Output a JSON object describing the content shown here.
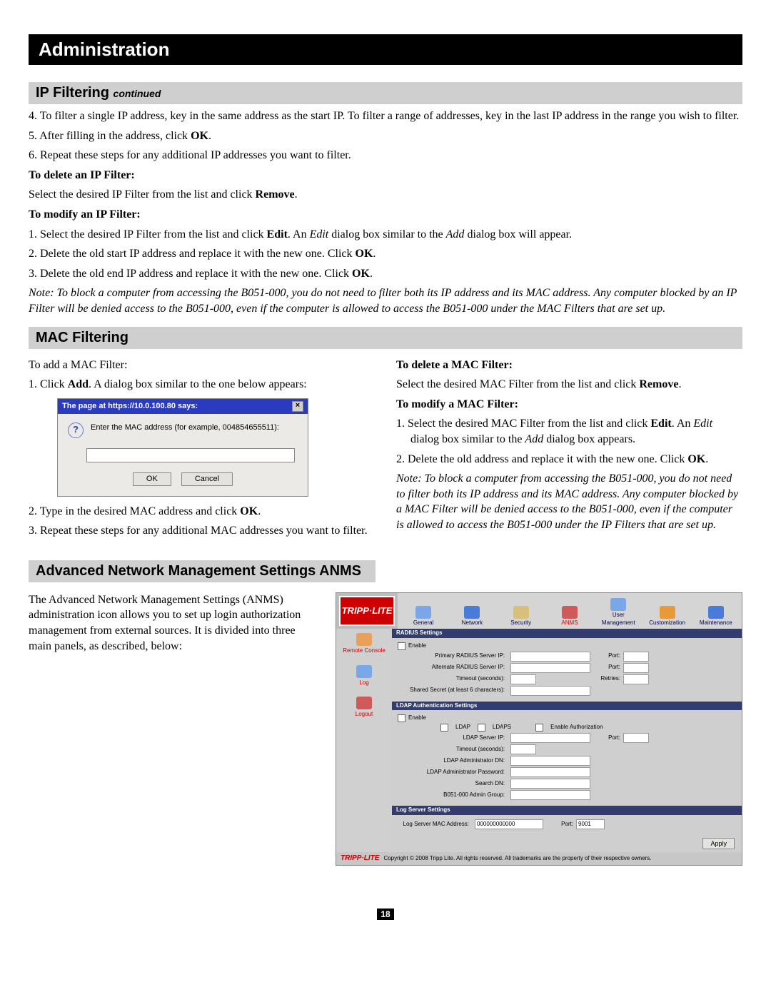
{
  "title": "Administration",
  "ip_filter": {
    "heading": "IP Filtering",
    "heading_sub": "continued",
    "step4": "4. To filter a single IP address, key in the same address as the start IP. To filter a range of addresses, key in the last IP address in the range you wish to filter.",
    "step5_pre": "5. After filling in the address, click ",
    "step5_b": "OK",
    "step5_post": ".",
    "step6": "6. Repeat these steps for any additional IP addresses you want to filter.",
    "delete_h": "To delete an IP Filter:",
    "delete_pre": "Select the desired IP Filter from the list and click ",
    "delete_b": "Remove",
    "delete_post": ".",
    "modify_h": "To modify an IP Filter:",
    "m1_pre": "1. Select the desired IP Filter from the list and click ",
    "m1_b": "Edit",
    "m1_mid": ". An ",
    "m1_i1": "Edit",
    "m1_mid2": " dialog box similar to the ",
    "m1_i2": "Add",
    "m1_post": " dialog box will appear.",
    "m2_pre": "2. Delete the old start IP address and replace it with the new one. Click ",
    "m2_b": "OK",
    "m2_post": ".",
    "m3_pre": "3. Delete the old end IP address and replace it with the new one. Click ",
    "m3_b": "OK",
    "m3_post": ".",
    "note": "Note: To block a computer from accessing the B051-000, you do not need to filter both its IP address and its MAC address. Any computer blocked by an IP Filter will be denied access to the B051-000, even if the computer is allowed to access the B051-000 under the MAC Filters that are set up."
  },
  "mac": {
    "heading": "MAC Filtering",
    "add_intro": "To add a MAC Filter:",
    "a1_pre": "1. Click ",
    "a1_b": "Add",
    "a1_post": ". A dialog box similar to the one below appears:",
    "a2_pre": "2. Type in the desired MAC address and click ",
    "a2_b": "OK",
    "a2_post": ".",
    "a3": "3. Repeat these steps for any additional MAC addresses you want to filter.",
    "del_h": "To delete a MAC Filter:",
    "del_pre": "Select the desired MAC Filter from the list and click ",
    "del_b": "Remove",
    "del_post": ".",
    "mod_h": "To modify a MAC Filter:",
    "mm1_pre": "1. Select the desired MAC Filter from the list and click ",
    "mm1_b": "Edit",
    "mm1_mid": ". An ",
    "mm1_i1": "Edit",
    "mm1_mid2": " dialog box similar to the ",
    "mm1_i2": "Add",
    "mm1_post": " dialog box appears.",
    "mm2_pre": "2. Delete the old address and replace it with the new one. Click ",
    "mm2_b": "OK",
    "mm2_post": ".",
    "note": "Note: To block a computer from accessing the B051-000, you do not need to filter both its IP address and its MAC address. Any computer blocked by a MAC Filter will be denied access to the B051-000, even if the computer is allowed to access the B051-000 under the IP Filters that are set up."
  },
  "dialog": {
    "title": "The page at https://10.0.100.80 says:",
    "msg": "Enter the MAC address (for example, 004854655511):",
    "ok": "OK",
    "cancel": "Cancel"
  },
  "anms": {
    "heading": "Advanced Network Management Settings ANMS",
    "intro": "The Advanced Network Management Settings (ANMS) administration icon allows you to set up login authorization management from external sources. It is divided into three main panels, as described, below:",
    "logo": "TRIPP·LITE",
    "toolbar": [
      "General",
      "Network",
      "Security",
      "ANMS",
      "User Management",
      "Customization",
      "Maintenance"
    ],
    "side": [
      "Remote Console",
      "Log",
      "Logout"
    ],
    "radius_h": "RADIUS Settings",
    "enable": "Enable",
    "r_primary": "Primary RADIUS Server IP:",
    "r_alt": "Alternate RADIUS Server IP:",
    "r_timeout": "Timeout (seconds):",
    "r_secret": "Shared Secret (at least 6 characters):",
    "port": "Port:",
    "retries": "Retries:",
    "ldap_h": "LDAP Authentication Settings",
    "ldap": "LDAP",
    "ldaps": "LDAPS",
    "enable_auth": "Enable Authorization",
    "l_server": "LDAP Server IP:",
    "l_timeout": "Timeout (seconds):",
    "l_admin_dn": "LDAP Administrator DN:",
    "l_admin_pw": "LDAP Administrator Password:",
    "l_search": "Search DN:",
    "l_group": "B051-000 Admin Group:",
    "log_h": "Log Server Settings",
    "log_mac_l": "Log Server MAC Address:",
    "log_mac_v": "000000000000",
    "log_port_l": "Port:",
    "log_port_v": "9001",
    "apply": "Apply",
    "copyright": "Copyright © 2008 Tripp Lite. All rights reserved. All trademarks are the property of their respective owners."
  },
  "page_number": "18"
}
